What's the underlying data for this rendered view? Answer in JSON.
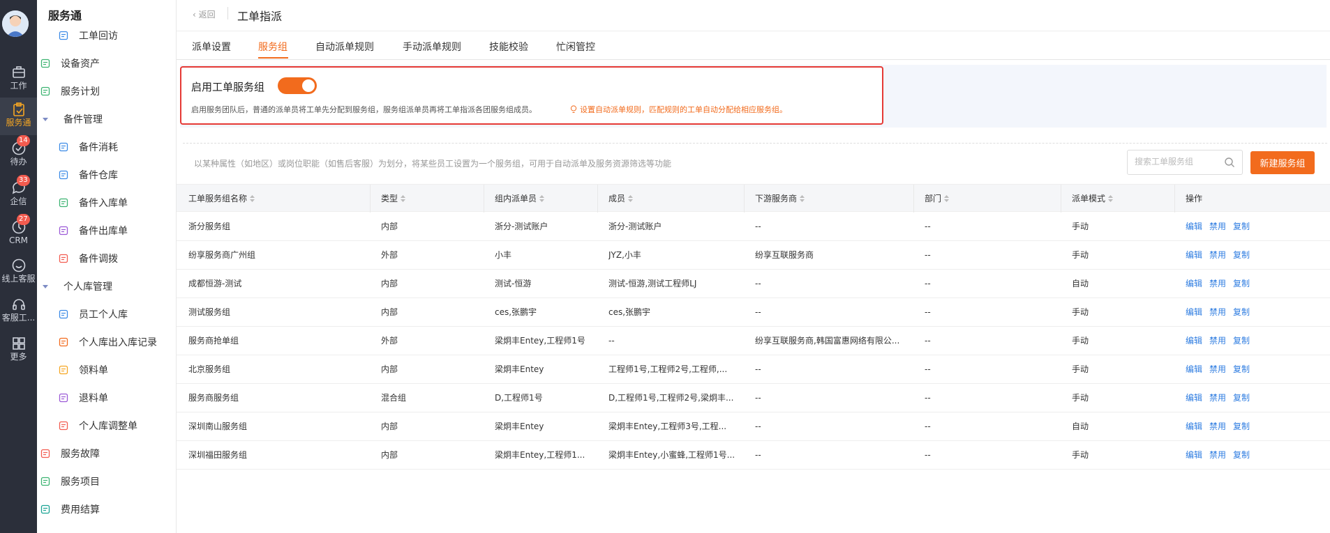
{
  "rail": {
    "items": [
      {
        "label": "工作",
        "icon": "briefcase-icon"
      },
      {
        "label": "服务通",
        "icon": "clipboard-icon"
      },
      {
        "label": "待办",
        "icon": "check-circle-icon",
        "badge": "14"
      },
      {
        "label": "企信",
        "icon": "chat-icon",
        "badge": "33"
      },
      {
        "label": "CRM",
        "icon": "clock-icon",
        "badge": "27"
      },
      {
        "label": "线上客服",
        "icon": "smile-icon"
      },
      {
        "label": "客服工...",
        "icon": "headset-icon"
      },
      {
        "label": "更多",
        "icon": "grid-icon"
      }
    ],
    "active_color": "#f5a623"
  },
  "sidebar": {
    "title": "服务通",
    "items": [
      {
        "label": "工单回访",
        "icon": "revisit-icon",
        "indent": 2
      },
      {
        "label": "设备资产",
        "icon": "device-icon",
        "indent": 1
      },
      {
        "label": "服务计划",
        "icon": "plan-icon",
        "indent": 1
      },
      {
        "label": "备件管理",
        "icon": "chevron-down-icon",
        "indent": 1
      },
      {
        "label": "备件消耗",
        "icon": "plug-icon",
        "indent": 2
      },
      {
        "label": "备件仓库",
        "icon": "warehouse-icon",
        "indent": 2
      },
      {
        "label": "备件入库单",
        "icon": "inbound-icon",
        "indent": 2
      },
      {
        "label": "备件出库单",
        "icon": "outbound-icon",
        "indent": 2
      },
      {
        "label": "备件调拨",
        "icon": "transfer-icon",
        "indent": 2
      },
      {
        "label": "个人库管理",
        "icon": "chevron-down-icon",
        "indent": 1
      },
      {
        "label": "员工个人库",
        "icon": "house-icon",
        "indent": 2
      },
      {
        "label": "个人库出入库记录",
        "icon": "record-icon",
        "indent": 2
      },
      {
        "label": "领料单",
        "icon": "pick-icon",
        "indent": 2
      },
      {
        "label": "退料单",
        "icon": "return-icon",
        "indent": 2
      },
      {
        "label": "个人库调整单",
        "icon": "adjust-icon",
        "indent": 2
      },
      {
        "label": "服务故障",
        "icon": "warning-icon",
        "indent": 1
      },
      {
        "label": "服务项目",
        "icon": "layers-icon",
        "indent": 1
      },
      {
        "label": "费用结算",
        "icon": "bill-icon",
        "indent": 1
      }
    ]
  },
  "header": {
    "back_label": "返回",
    "title": "工单指派"
  },
  "tabs": [
    {
      "label": "派单设置"
    },
    {
      "label": "服务组",
      "active": true
    },
    {
      "label": "自动派单规则"
    },
    {
      "label": "手动派单规则"
    },
    {
      "label": "技能校验"
    },
    {
      "label": "忙闲管控"
    }
  ],
  "panel": {
    "title": "启用工单服务组",
    "enabled": true,
    "desc": "启用服务团队后，普通的派单员将工单先分配到服务组，服务组派单员再将工单指派各团服务组成员。",
    "tip": "设置自动派单规则，匹配规则的工单自动分配给相应服务组。"
  },
  "toolbar": {
    "hint": "以某种属性（如地区）或岗位职能（如售后客服）为划分，将某些员工设置为一个服务组，可用于自动派单及服务资源筛选等功能",
    "search_placeholder": "搜索工单服务组",
    "new_button": "新建服务组"
  },
  "table": {
    "columns": [
      "工单服务组名称",
      "类型",
      "组内派单员",
      "成员",
      "下游服务商",
      "部门",
      "派单模式",
      "操作"
    ],
    "actions": [
      "编辑",
      "禁用",
      "复制"
    ],
    "rows": [
      [
        "浙分服务组",
        "内部",
        "浙分-测试账户",
        "浙分-测试账户",
        "--",
        "--",
        "手动"
      ],
      [
        "纷享服务商广州组",
        "外部",
        "小丰",
        "JYZ,小丰",
        "纷享互联服务商",
        "--",
        "手动"
      ],
      [
        "成都恒游-测试",
        "内部",
        "测试-恒游",
        "测试-恒游,测试工程师LJ",
        "--",
        "--",
        "自动"
      ],
      [
        "测试服务组",
        "内部",
        "ces,张鹏宇",
        "ces,张鹏宇",
        "--",
        "--",
        "手动"
      ],
      [
        "服务商抢单组",
        "外部",
        "梁炯丰Entey,工程师1号",
        "--",
        "纷享互联服务商,韩国富惠网络有限公...",
        "--",
        "手动"
      ],
      [
        "北京服务组",
        "内部",
        "梁炯丰Entey",
        "工程师1号,工程师2号,工程师,...",
        "--",
        "--",
        "手动"
      ],
      [
        "服务商服务组",
        "混合组",
        "D,工程师1号",
        "D,工程师1号,工程师2号,梁炯丰...",
        "--",
        "--",
        "手动"
      ],
      [
        "深圳南山服务组",
        "内部",
        "梁炯丰Entey",
        "梁炯丰Entey,工程师3号,工程...",
        "--",
        "--",
        "自动"
      ],
      [
        "深圳福田服务组",
        "内部",
        "梁炯丰Entey,工程师1...",
        "梁炯丰Entey,小蜜蜂,工程师1号...",
        "--",
        "--",
        "手动"
      ]
    ]
  },
  "colors": {
    "accent": "#f26b1d",
    "link": "#2f7de1",
    "highlight_border": "#e53935"
  }
}
